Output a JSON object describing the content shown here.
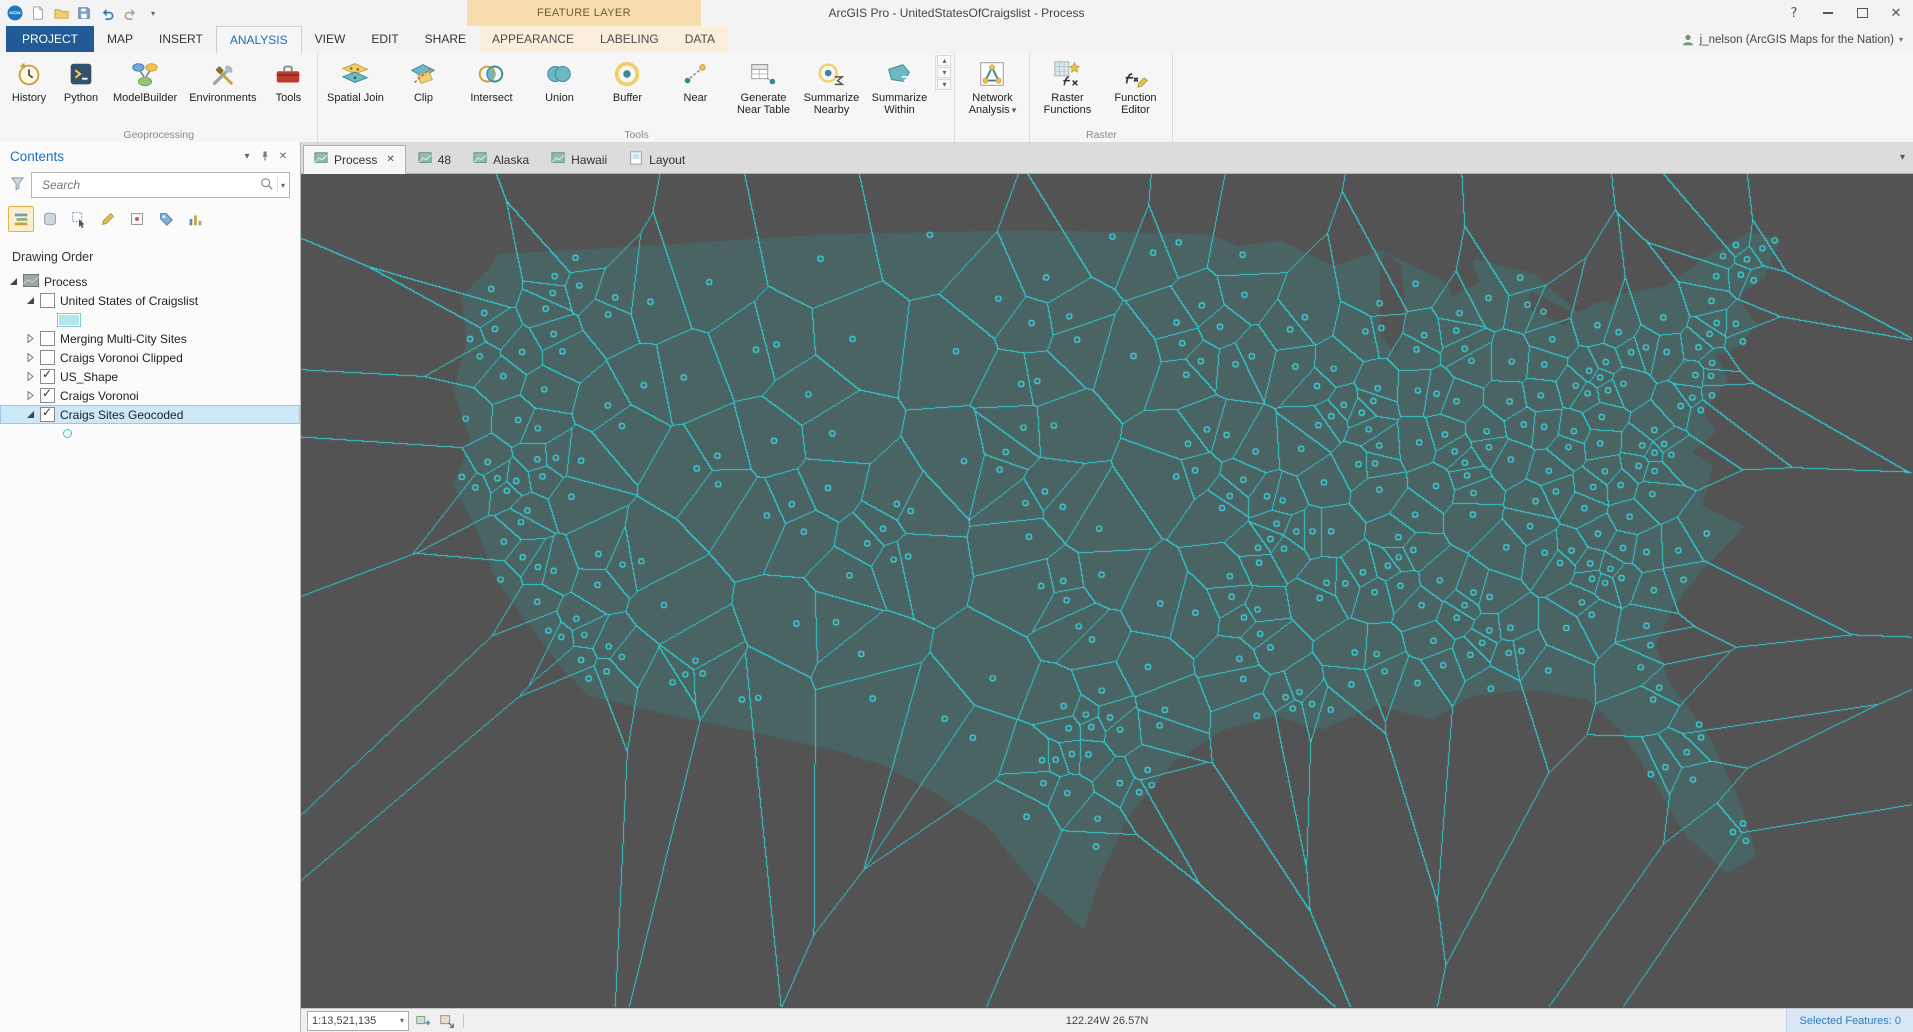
{
  "colors": {
    "accent": "#1d6fbd",
    "project_tab": "#215a94",
    "contextual_bg": "#f7dcae",
    "ribbon_bg": "#f6f6f6",
    "map_bg": "#535353",
    "land": "#4a6363",
    "voronoi": "#2fd8de",
    "point": "#3ee0e8",
    "selection_bg": "#cde8f7"
  },
  "glyphs": {
    "close": "✕",
    "chevron_down": "▾",
    "chevron_up": "▴",
    "help": "?"
  },
  "title_bar": {
    "app_title": "ArcGIS Pro - UnitedStatesOfCraigslist - Process",
    "contextual_group": "FEATURE LAYER"
  },
  "account": {
    "user": "j_nelson (ArcGIS Maps for the Nation)"
  },
  "ribbon": {
    "tabs": [
      {
        "label": "PROJECT",
        "style": "project"
      },
      {
        "label": "MAP"
      },
      {
        "label": "INSERT"
      },
      {
        "label": "ANALYSIS",
        "active": true
      },
      {
        "label": "VIEW"
      },
      {
        "label": "EDIT"
      },
      {
        "label": "SHARE"
      },
      {
        "label": "APPEARANCE",
        "contextual": true
      },
      {
        "label": "LABELING",
        "contextual": true
      },
      {
        "label": "DATA",
        "contextual": true
      }
    ],
    "groups": [
      {
        "label": "Geoprocessing",
        "items": [
          {
            "label": "History",
            "icon": "history"
          },
          {
            "label": "Python",
            "icon": "python"
          },
          {
            "label": "ModelBuilder",
            "icon": "modelbuilder"
          },
          {
            "label": "Environments",
            "icon": "environments"
          },
          {
            "label": "Tools",
            "icon": "toolbox"
          }
        ]
      },
      {
        "label": "Tools",
        "gallery": true,
        "items": [
          {
            "label": "Spatial Join",
            "icon": "spatial-join"
          },
          {
            "label": "Clip",
            "icon": "clip"
          },
          {
            "label": "Intersect",
            "icon": "intersect"
          },
          {
            "label": "Union",
            "icon": "union"
          },
          {
            "label": "Buffer",
            "icon": "buffer"
          },
          {
            "label": "Near",
            "icon": "near"
          },
          {
            "label": "Generate Near Table",
            "icon": "near-table"
          },
          {
            "label": "Summarize Nearby",
            "icon": "summarize-nearby"
          },
          {
            "label": "Summarize Within",
            "icon": "summarize-within"
          }
        ]
      },
      {
        "label": "",
        "items": [
          {
            "label": "Network Analysis",
            "icon": "network",
            "menu": true
          }
        ]
      },
      {
        "label": "Raster",
        "items": [
          {
            "label": "Raster Functions",
            "icon": "raster-fx"
          },
          {
            "label": "Function Editor",
            "icon": "fx-editor"
          }
        ]
      }
    ]
  },
  "contents": {
    "title": "Contents",
    "search_placeholder": "Search",
    "drawing_order": "Drawing Order",
    "tree": [
      {
        "label": "Process",
        "level": 0,
        "expander": "expanded",
        "icon": "map-item"
      },
      {
        "label": "United States of Craigslist",
        "level": 1,
        "expander": "expanded",
        "checked": false
      },
      {
        "swatch": "rect",
        "level": 2
      },
      {
        "label": "Merging Multi-City Sites",
        "level": 1,
        "expander": "collapsed",
        "checked": false
      },
      {
        "label": "Craigs Voronoi Clipped",
        "level": 1,
        "expander": "collapsed",
        "checked": false
      },
      {
        "label": "US_Shape",
        "level": 1,
        "expander": "collapsed",
        "checked": true
      },
      {
        "label": "Craigs Voronoi",
        "level": 1,
        "expander": "collapsed",
        "checked": true
      },
      {
        "label": "Craigs Sites Geocoded",
        "level": 1,
        "expander": "expanded",
        "checked": true,
        "selected": true
      },
      {
        "swatch": "point",
        "level": 2
      }
    ]
  },
  "view_tabs": [
    {
      "label": "Process",
      "active": true,
      "closable": true,
      "icon": "map"
    },
    {
      "label": "48",
      "icon": "map"
    },
    {
      "label": "Alaska",
      "icon": "map"
    },
    {
      "label": "Hawaii",
      "icon": "map"
    },
    {
      "label": "Layout",
      "icon": "layout"
    }
  ],
  "status_bar": {
    "scale": "1:13,521,135",
    "coordinates": "122.24W 26.57N",
    "selected_features": "Selected Features: 0"
  }
}
